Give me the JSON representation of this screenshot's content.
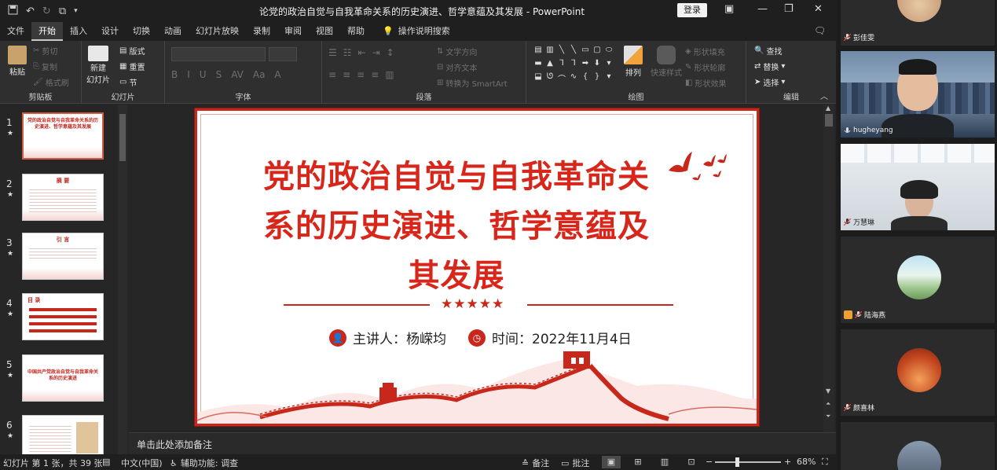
{
  "window": {
    "title": "论党的政治自觉与自我革命关系的历史演进、哲学意蕴及其发展 - PowerPoint",
    "login_label": "登录"
  },
  "tabs": [
    {
      "label": "文件",
      "active": false
    },
    {
      "label": "开始",
      "active": true
    },
    {
      "label": "插入",
      "active": false
    },
    {
      "label": "设计",
      "active": false
    },
    {
      "label": "切换",
      "active": false
    },
    {
      "label": "动画",
      "active": false
    },
    {
      "label": "幻灯片放映",
      "active": false
    },
    {
      "label": "录制",
      "active": false
    },
    {
      "label": "审阅",
      "active": false
    },
    {
      "label": "视图",
      "active": false
    },
    {
      "label": "帮助",
      "active": false
    }
  ],
  "tab_search": "操作说明搜索",
  "ribbon": {
    "clipboard": {
      "group_label": "剪贴板",
      "paste": "粘贴",
      "cut": "剪切",
      "copy": "复制",
      "format_painter": "格式刷"
    },
    "slides": {
      "group_label": "幻灯片",
      "new_slide": "新建",
      "new_slide_2": "幻灯片",
      "layout": "版式",
      "reset": "重置",
      "section": "节"
    },
    "font": {
      "group_label": "字体"
    },
    "paragraph": {
      "group_label": "段落",
      "text_direction": "文字方向",
      "align_text": "对齐文本",
      "smartart": "转换为 SmartArt"
    },
    "drawing": {
      "group_label": "绘图",
      "arrange": "排列",
      "quick_styles": "快速样式",
      "shape_fill": "形状填充",
      "shape_outline": "形状轮廓",
      "shape_effects": "形状效果"
    },
    "editing": {
      "group_label": "编辑",
      "find": "查找",
      "replace": "替换",
      "select": "选择"
    }
  },
  "thumbnails": [
    {
      "num": "1",
      "title": "党的政治自觉与自我革命关系的历史演进、哲学意蕴及其发展",
      "heading": "",
      "selected": true
    },
    {
      "num": "2",
      "title": "",
      "heading": "摘 要",
      "selected": false
    },
    {
      "num": "3",
      "title": "",
      "heading": "引 言",
      "selected": false
    },
    {
      "num": "4",
      "title": "",
      "heading": "目 录",
      "selected": false
    },
    {
      "num": "5",
      "title": "中国共产党政治自觉与自我革命关系的历史演进",
      "heading": "",
      "selected": false
    },
    {
      "num": "6",
      "title": "",
      "heading": "",
      "selected": false
    }
  ],
  "slide": {
    "title": "党的政治自觉与自我革命关系的历史演进、哲学意蕴及其发展",
    "stars": "★★★★★",
    "speaker_label": "主讲人：杨嵘均",
    "time_label": "时间：2022年11月4日"
  },
  "notes": {
    "placeholder": "单击此处添加备注"
  },
  "status": {
    "slide_info": "幻灯片 第 1 张，共 39 张",
    "language": "中文(中国)",
    "accessibility": "辅助功能: 调查",
    "notes_btn": "备注",
    "comments_btn": "批注",
    "zoom": "68%"
  },
  "participants": [
    {
      "name": "彭佳雯"
    },
    {
      "name": "hugheyang"
    },
    {
      "name": "万慧琳"
    },
    {
      "name": "陆海燕"
    },
    {
      "name": "颜喜林"
    }
  ],
  "colors": {
    "accent_red": "#c8281c",
    "title_red": "#d8261a",
    "ui_dark": "#262626"
  }
}
